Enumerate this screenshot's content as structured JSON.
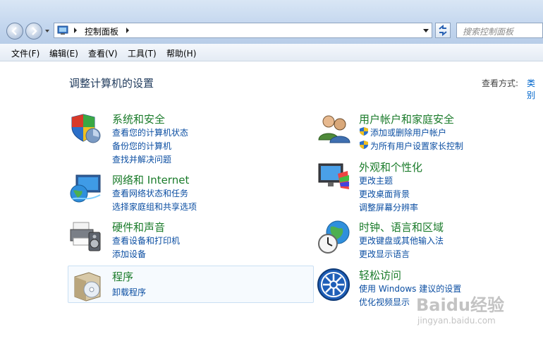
{
  "address": {
    "path": "控制面板",
    "search_placeholder": "搜索控制面板"
  },
  "menu": [
    "文件(F)",
    "编辑(E)",
    "查看(V)",
    "工具(T)",
    "帮助(H)"
  ],
  "page_title": "调整计算机的设置",
  "view_by": {
    "label": "查看方式:",
    "value": "类别"
  },
  "categories": {
    "system_security": {
      "title": "系统和安全",
      "links": [
        "查看您的计算机状态",
        "备份您的计算机",
        "查找并解决问题"
      ]
    },
    "network": {
      "title": "网络和 Internet",
      "links": [
        "查看网络状态和任务",
        "选择家庭组和共享选项"
      ]
    },
    "hardware": {
      "title": "硬件和声音",
      "links": [
        "查看设备和打印机",
        "添加设备"
      ]
    },
    "programs": {
      "title": "程序",
      "links": [
        "卸载程序"
      ]
    },
    "users": {
      "title": "用户帐户和家庭安全",
      "links": [
        "添加或删除用户帐户",
        "为所有用户设置家长控制"
      ]
    },
    "appearance": {
      "title": "外观和个性化",
      "links": [
        "更改主题",
        "更改桌面背景",
        "调整屏幕分辨率"
      ]
    },
    "clock": {
      "title": "时钟、语言和区域",
      "links": [
        "更改键盘或其他输入法",
        "更改显示语言"
      ]
    },
    "ease": {
      "title": "轻松访问",
      "links": [
        "使用 Windows 建议的设置",
        "优化视频显示"
      ]
    }
  },
  "watermark": {
    "brand": "Baidu经验",
    "url": "jingyan.baidu.com"
  }
}
